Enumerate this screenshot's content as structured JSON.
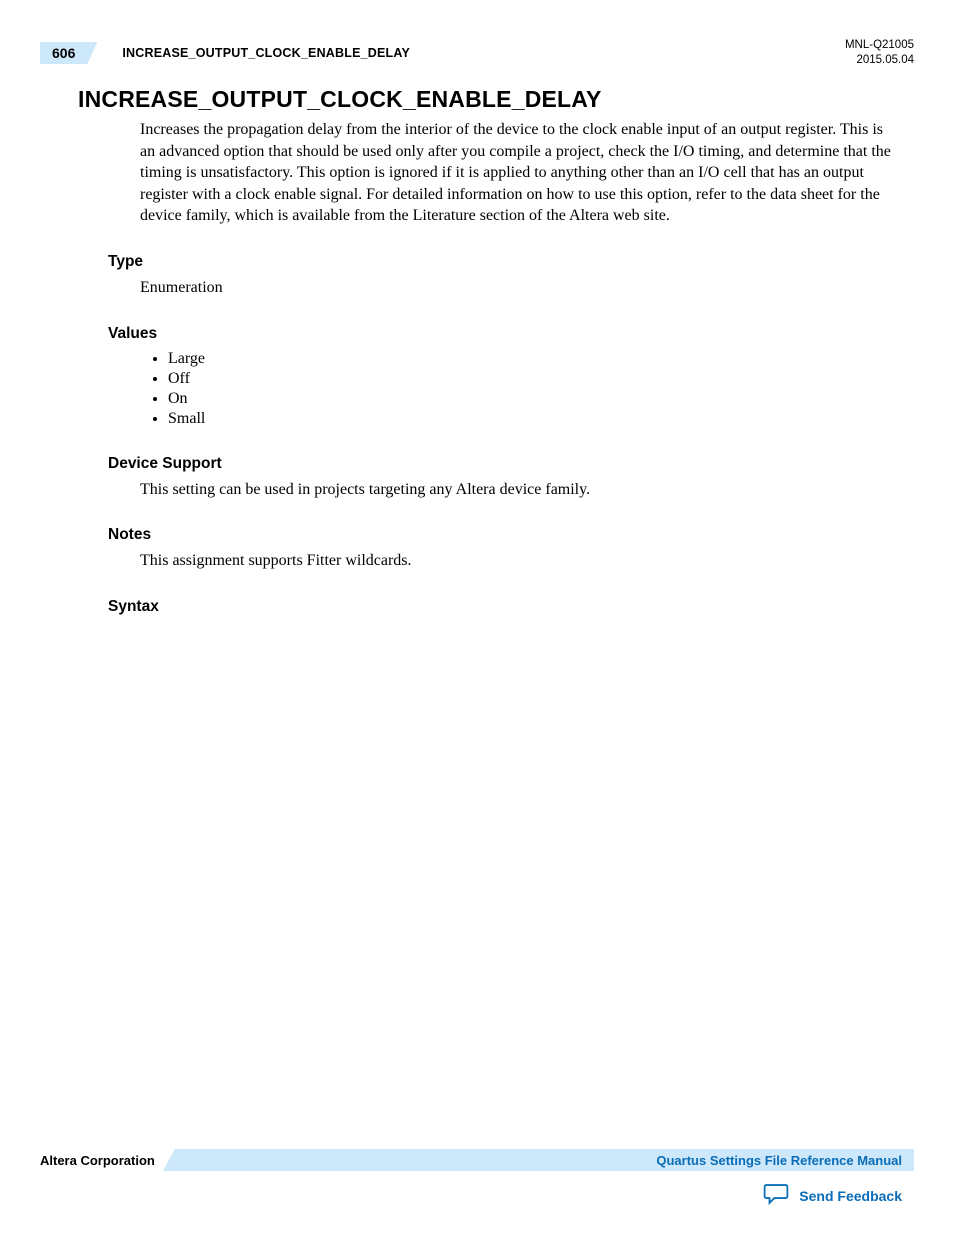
{
  "header": {
    "page_number": "606",
    "running_title": "INCREASE_OUTPUT_CLOCK_ENABLE_DELAY",
    "doc_id": "MNL-Q21005",
    "doc_date": "2015.05.04"
  },
  "main": {
    "heading": "INCREASE_OUTPUT_CLOCK_ENABLE_DELAY",
    "intro": "Increases the propagation delay from the interior of the device to the clock enable input of an output register. This is an advanced option that should be used only after you compile a project, check the I/O timing, and determine that the timing is unsatisfactory. This option is ignored if it is applied to anything other than an I/O cell that has an output register with a clock enable signal. For detailed information on how to use this option, refer to the data sheet for the device family, which is available from the Literature section of the Altera web site.",
    "sections": {
      "type": {
        "title": "Type",
        "body": "Enumeration"
      },
      "values": {
        "title": "Values",
        "items": [
          "Large",
          "Off",
          "On",
          "Small"
        ]
      },
      "device_support": {
        "title": "Device Support",
        "body": "This setting can be used in projects targeting any Altera device family."
      },
      "notes": {
        "title": "Notes",
        "body": "This assignment supports Fitter wildcards."
      },
      "syntax": {
        "title": "Syntax"
      }
    }
  },
  "footer": {
    "corporation": "Altera Corporation",
    "manual_title": "Quartus Settings File Reference Manual",
    "feedback_label": "Send Feedback"
  }
}
